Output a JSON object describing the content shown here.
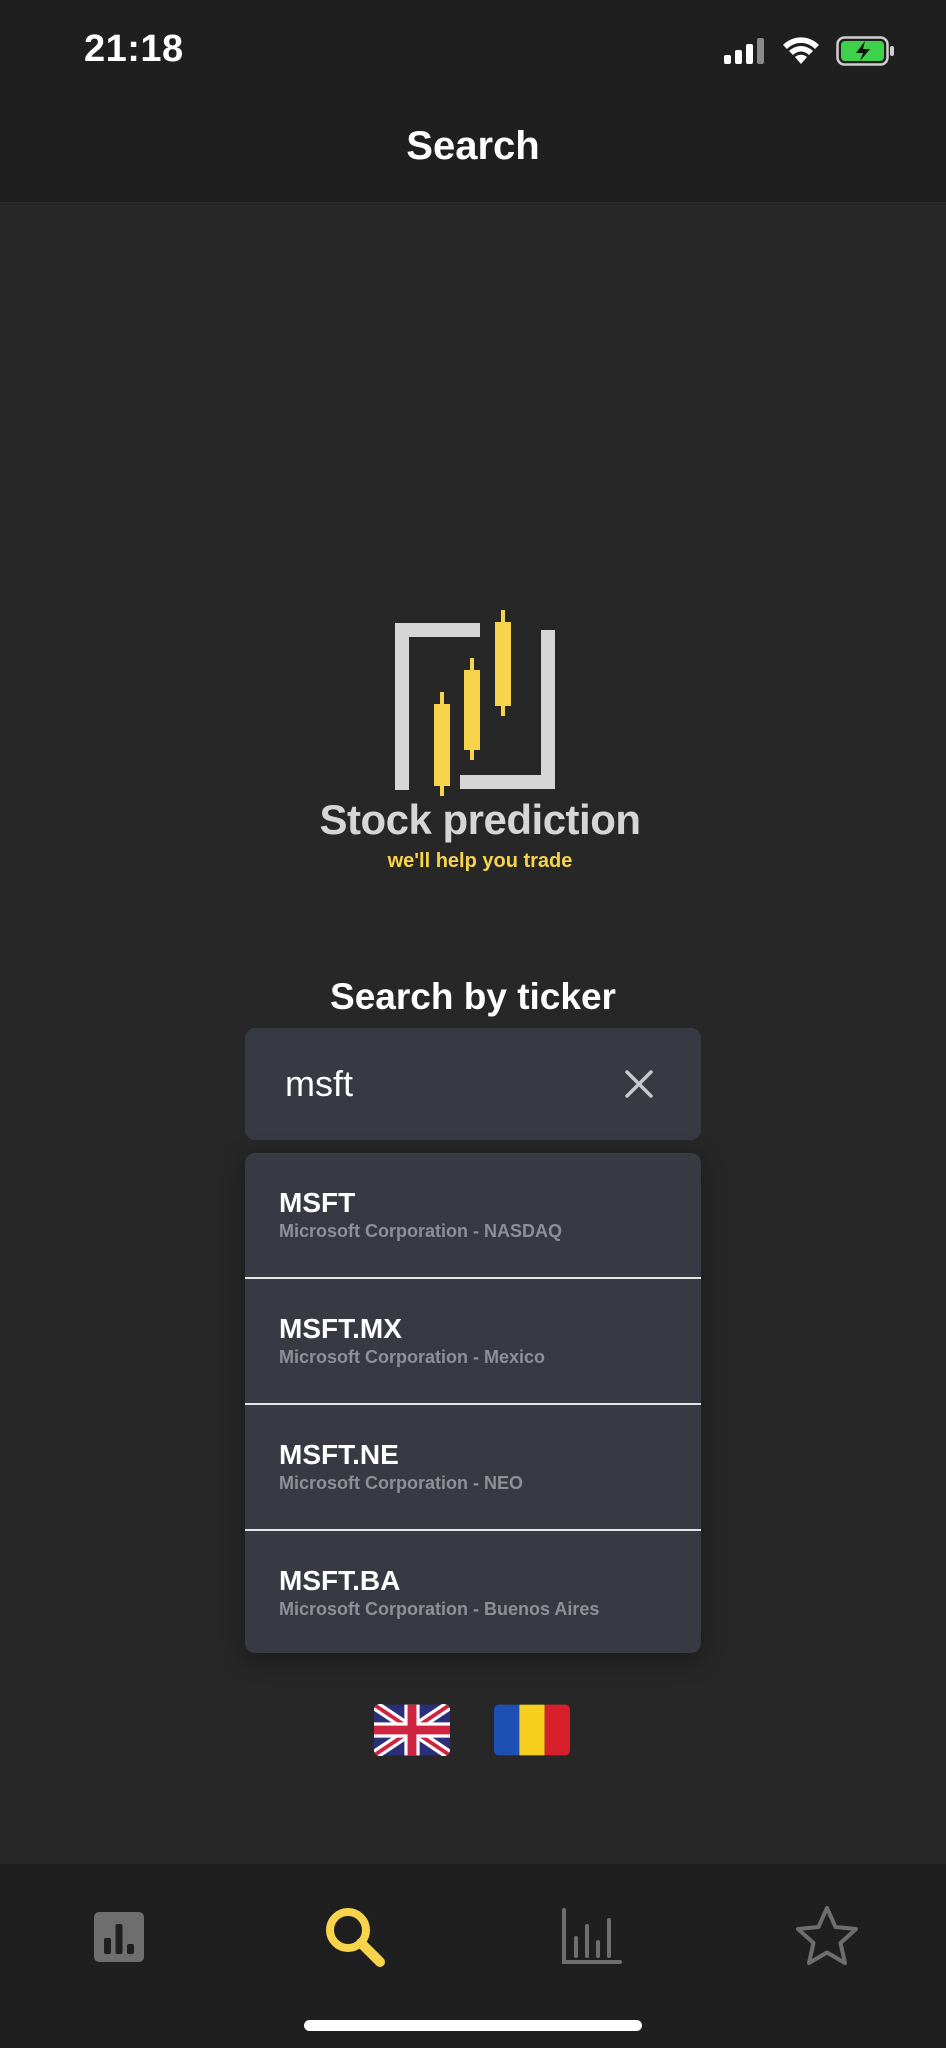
{
  "status_bar": {
    "time": "21:18",
    "icons": [
      "signal-icon",
      "wifi-icon",
      "battery-charging-icon"
    ]
  },
  "nav": {
    "title": "Search"
  },
  "logo": {
    "title": "Stock prediction",
    "tagline": "we'll help you trade",
    "accent_color": "#f7d44c"
  },
  "search": {
    "heading": "Search by ticker",
    "value": "msft",
    "placeholder": "",
    "clear_icon": "close-icon"
  },
  "results": [
    {
      "ticker": "MSFT",
      "subtitle": "Microsoft Corporation - NASDAQ"
    },
    {
      "ticker": "MSFT.MX",
      "subtitle": "Microsoft Corporation - Mexico"
    },
    {
      "ticker": "MSFT.NE",
      "subtitle": "Microsoft Corporation - NEO"
    },
    {
      "ticker": "MSFT.BA",
      "subtitle": "Microsoft Corporation - Buenos Aires"
    }
  ],
  "languages": [
    "uk-flag-icon",
    "romania-flag-icon"
  ],
  "tab_bar": {
    "tabs": [
      {
        "icon": "bar-chart-square-icon",
        "active": false
      },
      {
        "icon": "search-icon",
        "active": true
      },
      {
        "icon": "chart-icon",
        "active": false
      },
      {
        "icon": "star-icon",
        "active": false
      }
    ],
    "active_color": "#f7d44c",
    "inactive_color": "#6e6e6e"
  }
}
